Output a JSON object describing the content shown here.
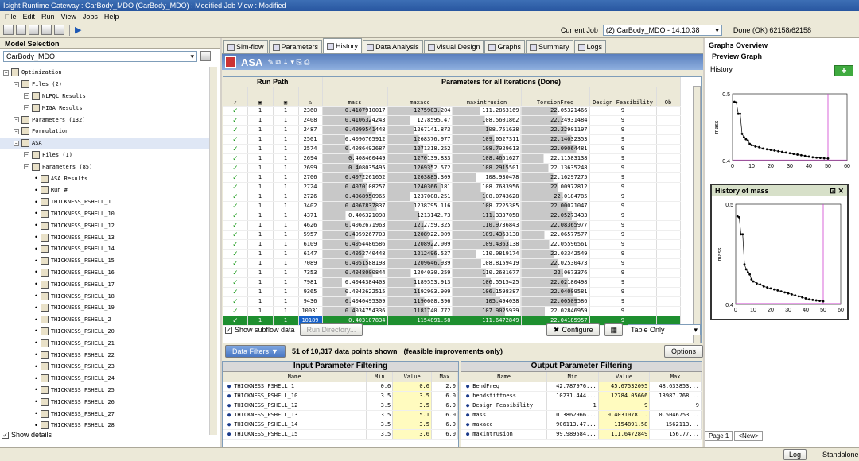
{
  "window": {
    "title": "Isight Runtime Gateway : CarBody_MDO (CarBody_MDO) : Modified Job View : Modified"
  },
  "menu": [
    "File",
    "Edit",
    "Run",
    "View",
    "Jobs",
    "Help"
  ],
  "toolbar": {
    "current_job_label": "Current Job",
    "current_job_value": "(2) CarBody_MDO - 14:10:38",
    "status_text": "Done (OK) 62158/62158"
  },
  "model_selection": {
    "title": "Model Selection",
    "model": "CarBody_MDO",
    "show_details": "Show details"
  },
  "tree": [
    {
      "d": 0,
      "t": "Optimization"
    },
    {
      "d": 1,
      "t": "Files (2)"
    },
    {
      "d": 2,
      "t": "NLPQL Results"
    },
    {
      "d": 2,
      "t": "MIGA Results"
    },
    {
      "d": 1,
      "t": "Parameters (132)"
    },
    {
      "d": 1,
      "t": "Formulation"
    },
    {
      "d": 1,
      "t": "ASA"
    },
    {
      "d": 2,
      "t": "Files (1)"
    },
    {
      "d": 2,
      "t": "Parameters (85)"
    },
    {
      "d": 3,
      "t": "ASA Results"
    },
    {
      "d": 3,
      "t": "Run #"
    },
    {
      "d": 3,
      "t": "THICKNESS_PSHELL_1"
    },
    {
      "d": 3,
      "t": "THICKNESS_PSHELL_10"
    },
    {
      "d": 3,
      "t": "THICKNESS_PSHELL_12"
    },
    {
      "d": 3,
      "t": "THICKNESS_PSHELL_13"
    },
    {
      "d": 3,
      "t": "THICKNESS_PSHELL_14"
    },
    {
      "d": 3,
      "t": "THICKNESS_PSHELL_15"
    },
    {
      "d": 3,
      "t": "THICKNESS_PSHELL_16"
    },
    {
      "d": 3,
      "t": "THICKNESS_PSHELL_17"
    },
    {
      "d": 3,
      "t": "THICKNESS_PSHELL_18"
    },
    {
      "d": 3,
      "t": "THICKNESS_PSHELL_19"
    },
    {
      "d": 3,
      "t": "THICKNESS_PSHELL_2"
    },
    {
      "d": 3,
      "t": "THICKNESS_PSHELL_20"
    },
    {
      "d": 3,
      "t": "THICKNESS_PSHELL_21"
    },
    {
      "d": 3,
      "t": "THICKNESS_PSHELL_22"
    },
    {
      "d": 3,
      "t": "THICKNESS_PSHELL_23"
    },
    {
      "d": 3,
      "t": "THICKNESS_PSHELL_24"
    },
    {
      "d": 3,
      "t": "THICKNESS_PSHELL_25"
    },
    {
      "d": 3,
      "t": "THICKNESS_PSHELL_26"
    },
    {
      "d": 3,
      "t": "THICKNESS_PSHELL_27"
    },
    {
      "d": 3,
      "t": "THICKNESS_PSHELL_28"
    }
  ],
  "tabs": [
    "Sim-flow",
    "Parameters",
    "History",
    "Data Analysis",
    "Visual Design",
    "Graphs",
    "Summary",
    "Logs"
  ],
  "active_tab": "History",
  "component_title": "ASA",
  "grid": {
    "group1": "Run Path",
    "group2": "Parameters for all iterations (Done)",
    "columns": [
      "mass",
      "maxacc",
      "maxintrusion",
      "TorsionFreq",
      "Design Feasibility",
      "Ob"
    ],
    "rows": [
      [
        "1",
        "1",
        "2360",
        "0.4107910017",
        "1275903.204",
        "111.2863169",
        "22.05321466",
        "9"
      ],
      [
        "1",
        "1",
        "2408",
        "0.4106324243",
        "1278595.47",
        "108.5601862",
        "22.24931484",
        "9"
      ],
      [
        "1",
        "1",
        "2487",
        "0.4099541448",
        "1267141.873",
        "108.751638",
        "22.22901197",
        "9"
      ],
      [
        "1",
        "1",
        "2501",
        "0.4096765912",
        "1268376.977",
        "109.0527311",
        "22.14032353",
        "9"
      ],
      [
        "1",
        "1",
        "2574",
        "0.4086492687",
        "1271318.252",
        "108.7929613",
        "22.09064481",
        "9"
      ],
      [
        "1",
        "1",
        "2694",
        "0.408460449",
        "1270139.833",
        "108.4651627",
        "22.11583138",
        "9"
      ],
      [
        "1",
        "1",
        "2699",
        "0.408035495",
        "1269352.572",
        "108.2915501",
        "22.13635248",
        "9"
      ],
      [
        "1",
        "1",
        "2706",
        "0.4072261652",
        "1263885.309",
        "108.930478",
        "22.16297275",
        "9"
      ],
      [
        "1",
        "1",
        "2724",
        "0.4070108257",
        "1240366.181",
        "108.7683956",
        "22.00972812",
        "9"
      ],
      [
        "1",
        "1",
        "2726",
        "0.4068950965",
        "1237008.251",
        "108.0743628",
        "22.0184785",
        "9"
      ],
      [
        "1",
        "1",
        "3402",
        "0.4067837837",
        "1238795.116",
        "108.7225385",
        "22.00021047",
        "9"
      ],
      [
        "1",
        "1",
        "4371",
        "0.406321098",
        "1213142.73",
        "111.3337058",
        "22.05273433",
        "9"
      ],
      [
        "1",
        "1",
        "4626",
        "0.4062671963",
        "1212759.325",
        "110.9736843",
        "22.08365977",
        "9"
      ],
      [
        "1",
        "1",
        "5957",
        "0.4059267703",
        "1208922.009",
        "109.4363138",
        "22.06577577",
        "9"
      ],
      [
        "1",
        "1",
        "6109",
        "0.4054486586",
        "1208922.009",
        "109.4363138",
        "22.05596561",
        "9"
      ],
      [
        "1",
        "1",
        "6147",
        "0.4052740448",
        "1212496.527",
        "110.0819174",
        "22.03342549",
        "9"
      ],
      [
        "1",
        "1",
        "7089",
        "0.4051588198",
        "1209646.939",
        "108.8159419",
        "22.02530473",
        "9"
      ],
      [
        "1",
        "1",
        "7353",
        "0.4048000844",
        "1204030.259",
        "110.2681677",
        "22.0673376",
        "9"
      ],
      [
        "1",
        "1",
        "7981",
        "0.4044384403",
        "1189553.913",
        "106.5515425",
        "22.02180498",
        "9"
      ],
      [
        "1",
        "1",
        "9365",
        "0.4042622515",
        "1192903.909",
        "106.1598387",
        "22.04009581",
        "9"
      ],
      [
        "1",
        "1",
        "9436",
        "0.4040495309",
        "1190608.396",
        "105.494038",
        "22.00509586",
        "9"
      ],
      [
        "1",
        "1",
        "10031",
        "0.4034754336",
        "1181740.772",
        "107.9025939",
        "22.02846959",
        "9"
      ],
      [
        "1",
        "1",
        "10189",
        "0.403107834",
        "1154891.58",
        "111.6472849",
        "22.04185957",
        "9"
      ]
    ]
  },
  "controls": {
    "show_subflow": "Show subflow data",
    "run_dir": "Run Directory...",
    "configure": "Configure",
    "view_mode": "Table Only",
    "data_filters": "Data Filters",
    "points_shown": "51 of 10,317 data points shown",
    "feasible_note": "(feasible improvements only)",
    "options": "Options"
  },
  "input_filter": {
    "title": "Input Parameter Filtering",
    "cols": [
      "Name",
      "Min",
      "Value",
      "Max"
    ],
    "rows": [
      [
        "THICKNESS_PSHELL_1",
        "0.6",
        "0.6",
        "2.0"
      ],
      [
        "THICKNESS_PSHELL_10",
        "3.5",
        "3.5",
        "6.0"
      ],
      [
        "THICKNESS_PSHELL_12",
        "3.5",
        "3.5",
        "6.0"
      ],
      [
        "THICKNESS_PSHELL_13",
        "3.5",
        "5.1",
        "6.0"
      ],
      [
        "THICKNESS_PSHELL_14",
        "3.5",
        "3.5",
        "6.0"
      ],
      [
        "THICKNESS_PSHELL_15",
        "3.5",
        "3.6",
        "6.0"
      ]
    ]
  },
  "output_filter": {
    "title": "Output Parameter Filtering",
    "cols": [
      "Name",
      "Min",
      "Value",
      "Max"
    ],
    "rows": [
      [
        "BendFreq",
        "42.787976...",
        "45.67532095",
        "48.633853..."
      ],
      [
        "bendstiffness",
        "10231.444...",
        "12784.05666",
        "13987.768..."
      ],
      [
        "Design Feasibility",
        "1",
        "9",
        "9"
      ],
      [
        "mass",
        "0.3862966...",
        "0.4031078...",
        "0.5046753..."
      ],
      [
        "maxacc",
        "906113.47...",
        "1154891.58",
        "1562113..."
      ],
      [
        "maxintrusion",
        "99.989584...",
        "111.6472849",
        "156.77..."
      ]
    ]
  },
  "graphs": {
    "title": "Graphs Overview",
    "preview": "Preview Graph",
    "history": "History",
    "history_of": "History of mass",
    "chart_data": {
      "type": "line",
      "ylabel": "mass",
      "ylim": [
        0.4,
        0.5
      ],
      "xlim": [
        0,
        60
      ],
      "xticks": [
        0,
        10,
        20,
        30,
        40,
        50,
        60
      ],
      "yticks": [
        0.4,
        0.5
      ],
      "marker_x": 50,
      "x": [
        1,
        2,
        3,
        4,
        5,
        6,
        7,
        8,
        9,
        10,
        12,
        14,
        16,
        18,
        20,
        22,
        24,
        26,
        28,
        30,
        32,
        34,
        36,
        38,
        40,
        42,
        44,
        46,
        48,
        50
      ],
      "y": [
        0.488,
        0.487,
        0.47,
        0.47,
        0.44,
        0.435,
        0.432,
        0.43,
        0.425,
        0.423,
        0.421,
        0.42,
        0.418,
        0.417,
        0.416,
        0.415,
        0.414,
        0.413,
        0.412,
        0.411,
        0.41,
        0.409,
        0.408,
        0.407,
        0.406,
        0.405,
        0.4045,
        0.404,
        0.4035,
        0.4031
      ]
    }
  },
  "page_tabs": [
    "Page 1",
    "<New>"
  ],
  "status": {
    "log": "Log",
    "mode": "Standalone"
  }
}
